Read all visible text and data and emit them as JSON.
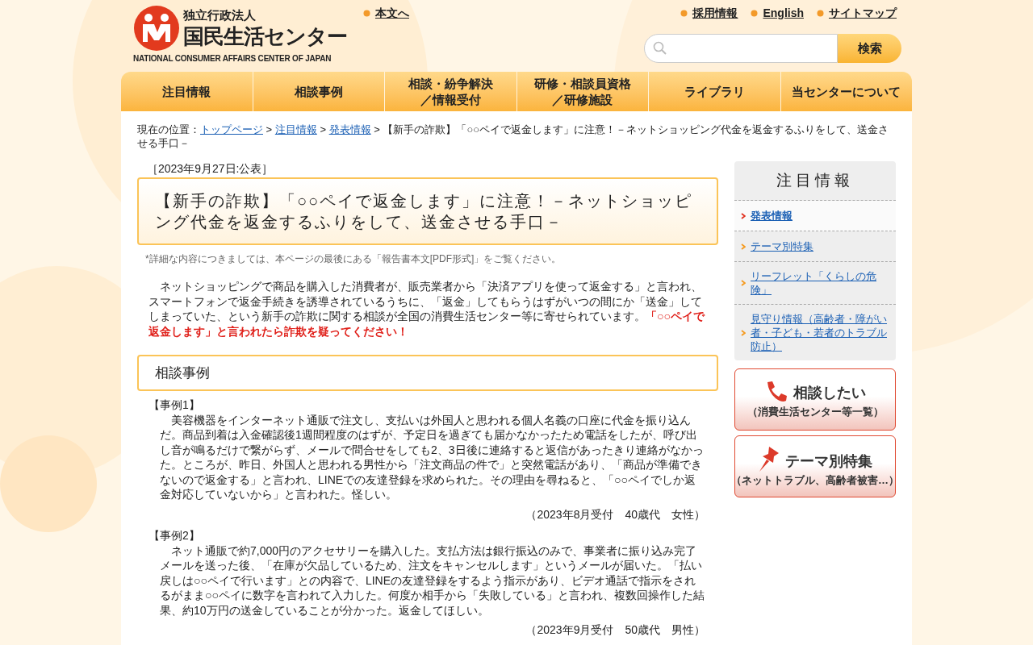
{
  "header": {
    "logo": {
      "org_type": "独立行政法人",
      "name": "国民生活センター",
      "english": "NATIONAL CONSUMER AFFAIRS CENTER OF JAPAN"
    },
    "skip_link": "本文へ",
    "utility_links": [
      "採用情報",
      "English",
      "サイトマップ"
    ],
    "search": {
      "button": "検索"
    }
  },
  "nav": [
    {
      "lines": [
        "注目情報"
      ]
    },
    {
      "lines": [
        "相談事例"
      ]
    },
    {
      "lines": [
        "相談・紛争解決",
        "／情報受付"
      ]
    },
    {
      "lines": [
        "研修・相談員資格",
        "／研修施設"
      ]
    },
    {
      "lines": [
        "ライブラリ"
      ]
    },
    {
      "lines": [
        "当センターについて"
      ]
    }
  ],
  "breadcrumb": {
    "prefix": "現在の位置：",
    "links": [
      "トップページ",
      "注目情報",
      "発表情報"
    ],
    "separator": ">",
    "current": "【新手の詐欺】「○○ペイで返金します」に注意！－ネットショッピング代金を返金するふりをして、送金させる手口－"
  },
  "article": {
    "date": "［2023年9月27日:公表］",
    "title": "【新手の詐欺】「○○ペイで返金します」に注意！－ネットショッピング代金を返金するふりをして、送金させる手口－",
    "note": "*詳細な内容につきましては、本ページの最後にある「報告書本文[PDF形式]」をご覧ください。",
    "intro": "　ネットショッピングで商品を購入した消費者が、販売業者から「決済アプリを使って返金する」と言われ、スマートフォンで返金手続きを誘導されているうちに、「返金」してもらうはずがいつの間にか「送金」してしまっていた、という新手の詐欺に関する相談が全国の消費生活センター等に寄せられています。**「○○ペイで返金します」と言われたら詐欺を疑ってください！**",
    "section_heading": "相談事例",
    "cases": [
      {
        "label": "【事例1】",
        "body": "　美容機器をインターネット通販で注文し、支払いは外国人と思われる個人名義の口座に代金を振り込んだ。商品到着は入金確認後1週間程度のはずが、予定日を過ぎても届かなかったため電話をしたが、呼び出し音が鳴るだけで繋がらず、メールで問合せをしても2、3日後に連絡すると返信があったきり連絡がなかった。ところが、昨日、外国人と思われる男性から「注文商品の件で」と突然電話があり、「商品が準備できないので返金する」と言われ、LINEでの友達登録を求められた。その理由を尋ねると、「○○ペイでしか返金対応していないから」と言われた。怪しい。",
        "note": "（2023年8月受付　40歳代　女性）"
      },
      {
        "label": "【事例2】",
        "body": "　ネット通販で約7,000円のアクセサリーを購入した。支払方法は銀行振込のみで、事業者に振り込み完了メールを送った後、「在庫が欠品しているため、注文をキャンセルします」というメールが届いた。「払い戻しは○○ペイで行います」との内容で、LINEの友達登録をするよう指示があり、ビデオ通話で指示をされるがまま○○ペイに数字を言われて入力した。何度か相手から「失敗している」と言われ、複数回操作した結果、約10万円の送金していることが分かった。返金してほしい。",
        "note": "（2023年9月受付　50歳代　男性）"
      }
    ]
  },
  "sidebar": {
    "title": "注目情報",
    "items": [
      {
        "label": "発表情報",
        "selected": true
      },
      {
        "label": "テーマ別特集",
        "selected": false
      },
      {
        "label": "リーフレット「くらしの危険」",
        "selected": false
      },
      {
        "label": "見守り情報（高齢者・障がい者・子ども・若者のトラブル防止）",
        "selected": false
      }
    ],
    "banners": [
      {
        "kind": "phone",
        "title": "相談したい",
        "subtitle": "（消費生活センター等一覧）"
      },
      {
        "kind": "pin",
        "title": "テーマ別特集",
        "subtitle": "（ネットトラブル、高齢者被害…）"
      }
    ]
  }
}
